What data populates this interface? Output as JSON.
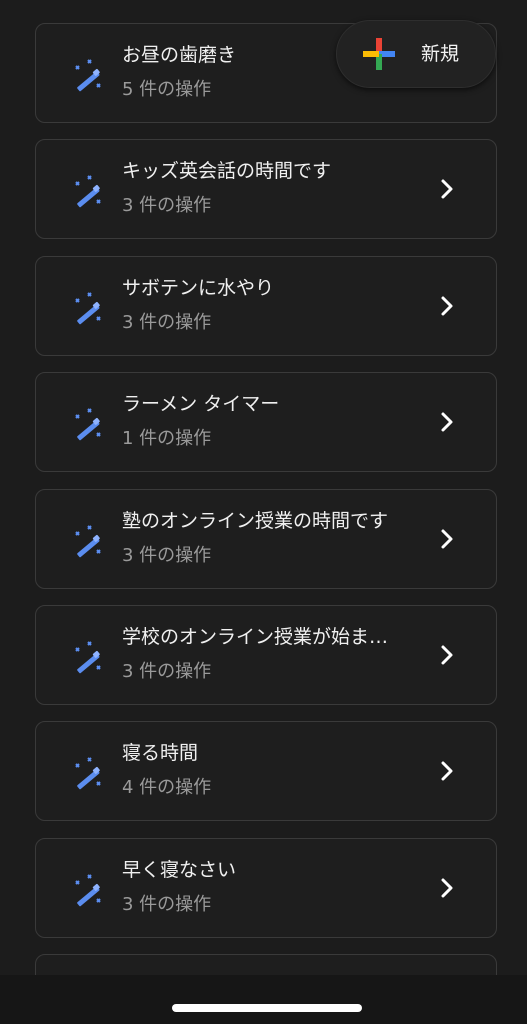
{
  "fab": {
    "label": "新規",
    "icon": "multicolor-plus-icon",
    "colors": {
      "red": "#ea4335",
      "blue": "#4285f4",
      "yellow": "#fbbc05",
      "green": "#34a853"
    }
  },
  "theme": {
    "accent": "#5b8def",
    "background": "#1c1c1c",
    "card_border": "#3a3a3a"
  },
  "routines": [
    {
      "title": "お昼の歯磨き",
      "subtitle": "5 件の操作",
      "icon": "magic-wand-icon"
    },
    {
      "title": "キッズ英会話の時間です",
      "subtitle": "3 件の操作",
      "icon": "magic-wand-icon"
    },
    {
      "title": "サボテンに水やり",
      "subtitle": "3 件の操作",
      "icon": "magic-wand-icon"
    },
    {
      "title": "ラーメン タイマー",
      "subtitle": "1 件の操作",
      "icon": "magic-wand-icon"
    },
    {
      "title": "塾のオンライン授業の時間です",
      "subtitle": "3 件の操作",
      "icon": "magic-wand-icon"
    },
    {
      "title": "学校のオンライン授業が始ま…",
      "subtitle": "3 件の操作",
      "icon": "magic-wand-icon"
    },
    {
      "title": "寝る時間",
      "subtitle": "4 件の操作",
      "icon": "magic-wand-icon"
    },
    {
      "title": "早く寝なさい",
      "subtitle": "3 件の操作",
      "icon": "magic-wand-icon"
    }
  ]
}
